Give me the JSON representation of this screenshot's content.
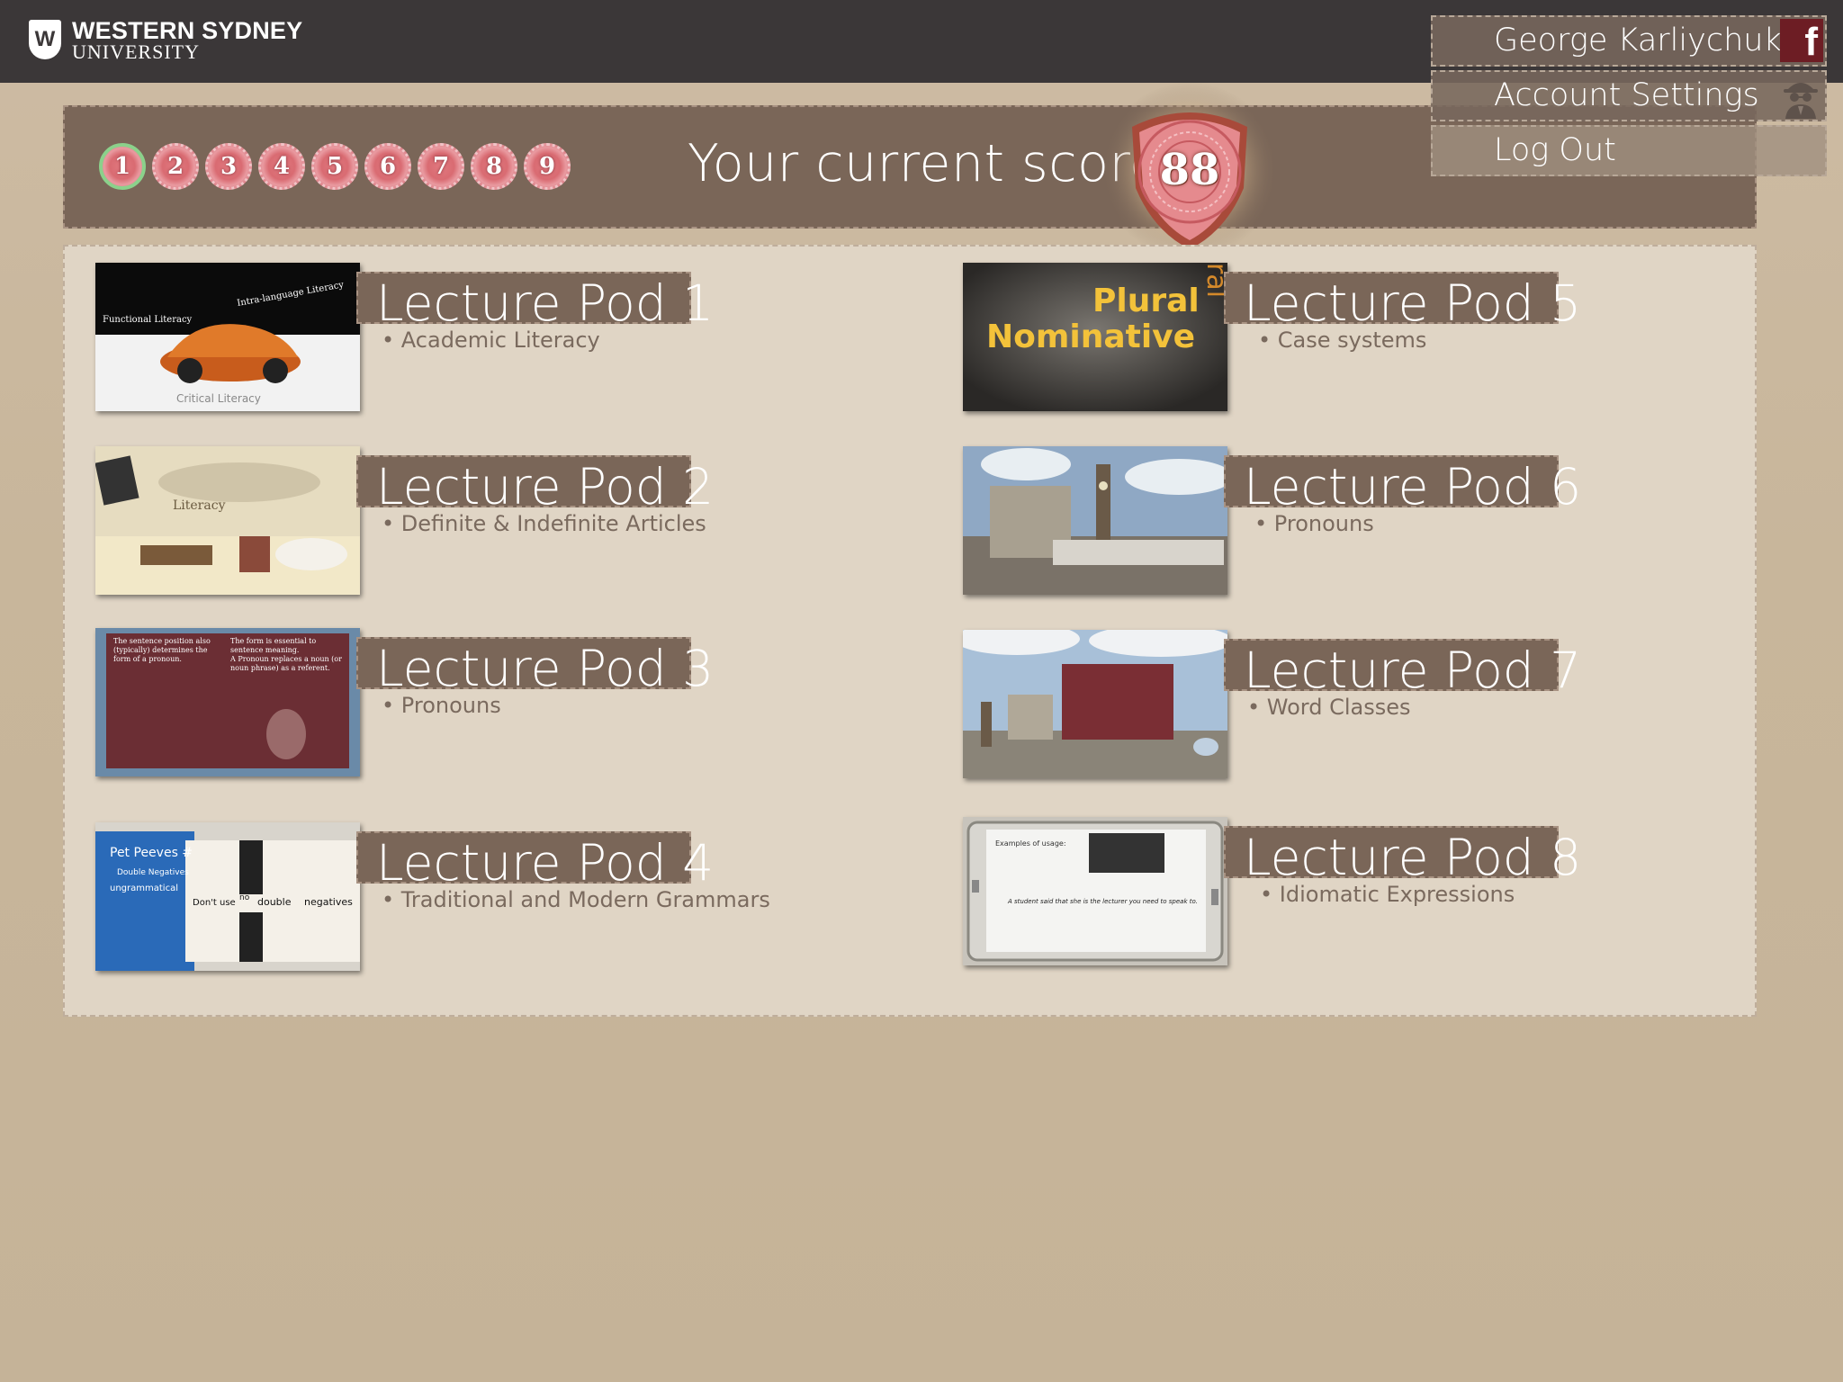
{
  "header": {
    "logo_line1": "WESTERN SYDNEY",
    "logo_line2": "UNIVERSITY",
    "logo_letter": "W"
  },
  "account_menu": {
    "user_name": "George Karliychuk",
    "account_settings": "Account Settings",
    "log_out": "Log Out",
    "facebook_icon": "f"
  },
  "score": {
    "label": "Your current score:",
    "value": "88",
    "levels": [
      "1",
      "2",
      "3",
      "4",
      "5",
      "6",
      "7",
      "8",
      "9"
    ],
    "current_level": "1"
  },
  "pods": [
    {
      "title": "Lecture Pod 1",
      "subtitle": "Academic Literacy",
      "thumb_texts": [
        "Functional Literacy",
        "Intra-language Literacy",
        "Critical Literacy"
      ]
    },
    {
      "title": "Lecture Pod 2",
      "subtitle": "Definite & Indefinite Articles",
      "thumb_texts": [
        "Literacy"
      ]
    },
    {
      "title": "Lecture Pod 3",
      "subtitle": "Pronouns",
      "thumb_texts": [
        "The sentence position also (typically) determines the form of a pronoun.",
        "The form is essential to sentence meaning.",
        "A Pronoun replaces a noun (or noun phrase) as a referent."
      ]
    },
    {
      "title": "Lecture Pod 4",
      "subtitle": "Traditional and Modern Grammars",
      "thumb_texts": [
        "Pet Peeves #",
        "Double Negatives",
        "ungrammatical",
        "Don't use",
        "no",
        "double",
        "negatives"
      ]
    },
    {
      "title": "Lecture Pod 5",
      "subtitle": "Case systems",
      "thumb_texts": [
        "Plural",
        "Nominative",
        "ral"
      ]
    },
    {
      "title": "Lecture Pod 6",
      "subtitle": "Pronouns",
      "thumb_texts": []
    },
    {
      "title": "Lecture Pod 7",
      "subtitle": "Word Classes",
      "thumb_texts": []
    },
    {
      "title": "Lecture Pod 8",
      "subtitle": "Idiomatic Expressions",
      "thumb_texts": [
        "Examples of usage:",
        "A student said that she is the lecturer you need to speak to."
      ]
    }
  ],
  "colors": {
    "topbar": "#3b3738",
    "panel_bg": "#e0d5c5",
    "title_box": "#7a6658",
    "facebook": "#6d1d24",
    "badge": "#d96b72"
  }
}
